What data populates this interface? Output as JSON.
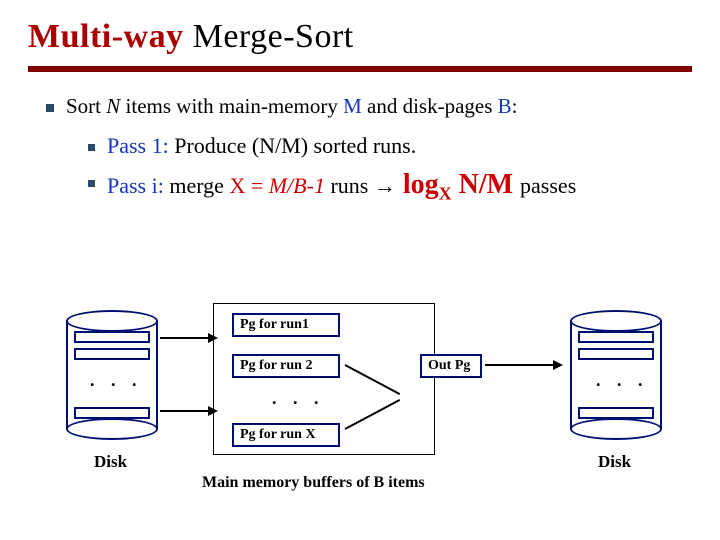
{
  "title": {
    "red": "Multi-way",
    "rest": " Merge-Sort"
  },
  "bullet1": {
    "pre": "Sort ",
    "n": "N",
    "mid": " items with main-memory ",
    "m": "M",
    "mid2": " and disk-pages ",
    "b": "B",
    "post": ":"
  },
  "bullet2a": {
    "label": "Pass 1:",
    "text": " Produce (N/M) sorted runs."
  },
  "bullet2b": {
    "label": "Pass i:",
    "pre": " merge ",
    "x": "X = ",
    "mb1": "M/B-1",
    "runs": " runs ",
    "arrow": "→",
    "log": " log",
    "sub": "X",
    "nm": " N/M ",
    "passes": "passes"
  },
  "boxes": {
    "r1": "Pg for run1",
    "r2": "Pg for run 2",
    "rx": "Pg for run X",
    "out": "Out Pg"
  },
  "labels": {
    "disk": "Disk",
    "main": "Main memory buffers of B items",
    "dots": ". . ."
  }
}
